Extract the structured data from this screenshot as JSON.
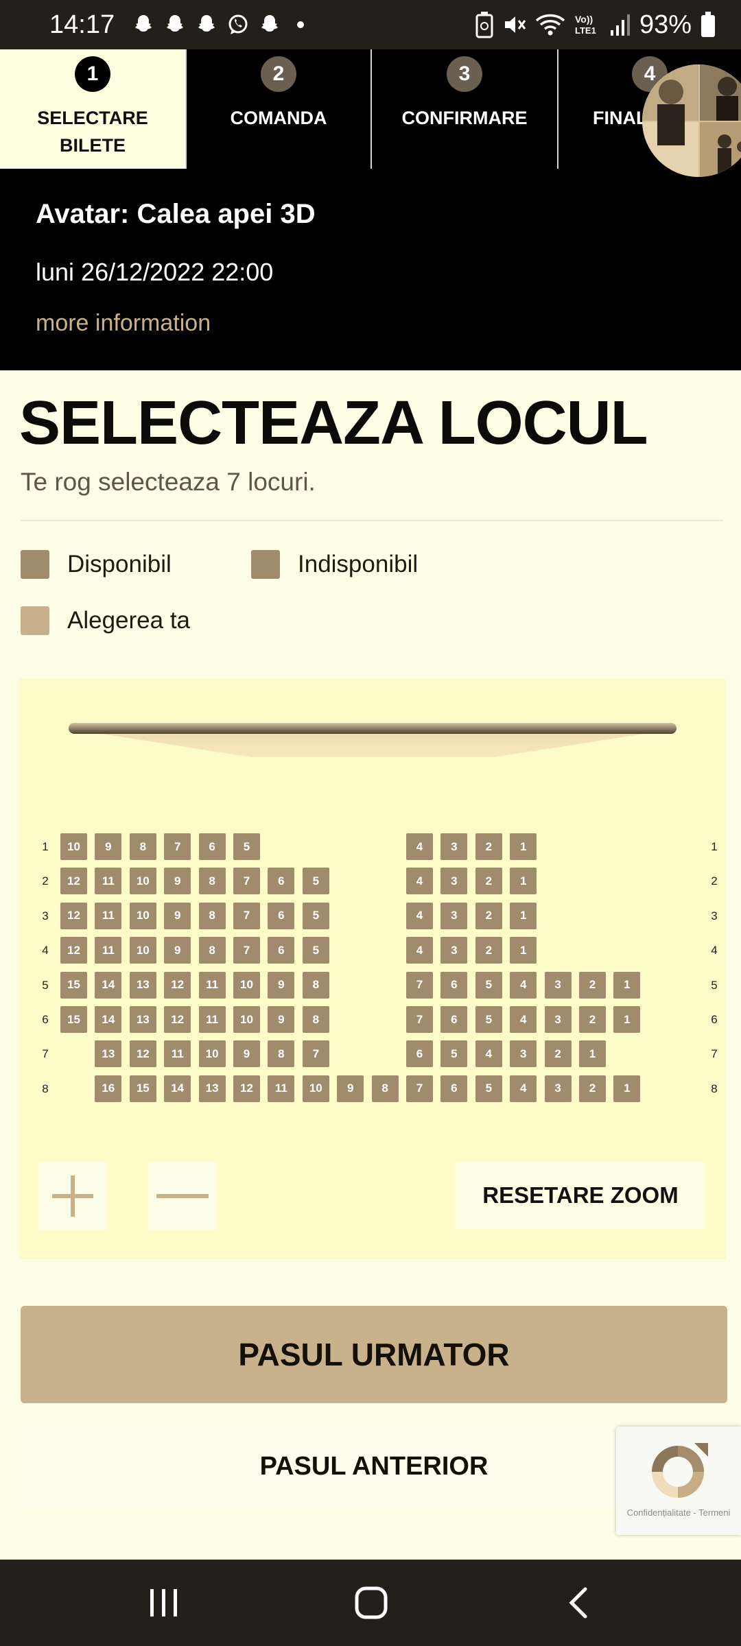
{
  "status_bar": {
    "time": "14:17",
    "battery": "93%",
    "icons_left": [
      "snapchat-icon",
      "snapchat-icon",
      "snapchat-icon",
      "whatsapp-icon",
      "snapchat-icon"
    ],
    "icons_right": [
      "battery-saver-icon",
      "mute-icon",
      "wifi-icon",
      "volte-icon",
      "signal-icon",
      "battery-icon"
    ]
  },
  "steps": [
    {
      "number": "1",
      "label": "SELECTARE\nBILETE"
    },
    {
      "number": "2",
      "label": "COMANDA"
    },
    {
      "number": "3",
      "label": "CONFIRMARE"
    },
    {
      "number": "4",
      "label": "FINAL"
    }
  ],
  "movie": {
    "title": "Avatar: Calea apei 3D",
    "datetime": "luni 26/12/2022 22:00",
    "more_link": "more information"
  },
  "seat_selection": {
    "title": "SELECTEAZA LOCUL",
    "subtitle": "Te rog selecteaza 7 locuri.",
    "legend": [
      {
        "label": "Disponibil",
        "color": "#a08b6d"
      },
      {
        "label": "Indisponibil",
        "color": "#a08b6d"
      },
      {
        "label": "Alegerea ta",
        "color": "#c9b08d"
      }
    ],
    "rows": [
      {
        "row": "1",
        "left": [
          "10",
          "9",
          "8",
          "7",
          "6",
          "5"
        ],
        "right": [
          "4",
          "3",
          "2",
          "1"
        ]
      },
      {
        "row": "2",
        "left": [
          "12",
          "11",
          "10",
          "9",
          "8",
          "7",
          "6",
          "5"
        ],
        "right": [
          "4",
          "3",
          "2",
          "1"
        ]
      },
      {
        "row": "3",
        "left": [
          "12",
          "11",
          "10",
          "9",
          "8",
          "7",
          "6",
          "5"
        ],
        "right": [
          "4",
          "3",
          "2",
          "1"
        ]
      },
      {
        "row": "4",
        "left": [
          "12",
          "11",
          "10",
          "9",
          "8",
          "7",
          "6",
          "5"
        ],
        "right": [
          "4",
          "3",
          "2",
          "1"
        ]
      },
      {
        "row": "5",
        "left": [
          "15",
          "14",
          "13",
          "12",
          "11",
          "10",
          "9",
          "8"
        ],
        "right": [
          "7",
          "6",
          "5",
          "4",
          "3",
          "2",
          "1"
        ]
      },
      {
        "row": "6",
        "left": [
          "15",
          "14",
          "13",
          "12",
          "11",
          "10",
          "9",
          "8"
        ],
        "right": [
          "7",
          "6",
          "5",
          "4",
          "3",
          "2",
          "1"
        ]
      },
      {
        "row": "7",
        "left": [
          "13",
          "12",
          "11",
          "10",
          "9",
          "8",
          "7"
        ],
        "right": [
          "6",
          "5",
          "4",
          "3",
          "2",
          "1"
        ]
      },
      {
        "row": "8",
        "left": [
          "16",
          "15",
          "14",
          "13",
          "12",
          "11",
          "10",
          "9",
          "8"
        ],
        "right": [
          "7",
          "6",
          "5",
          "4",
          "3",
          "2",
          "1"
        ]
      }
    ],
    "zoom_in_icon": "plus-icon",
    "zoom_out_icon": "minus-icon",
    "reset_zoom_label": "RESETARE ZOOM"
  },
  "buttons": {
    "next": "PASUL URMATOR",
    "previous": "PASUL ANTERIOR"
  },
  "recaptcha": {
    "text": "Confidențialitate - Termeni"
  },
  "nav_bar": {
    "icons": [
      "recents-icon",
      "home-icon",
      "back-icon"
    ]
  }
}
